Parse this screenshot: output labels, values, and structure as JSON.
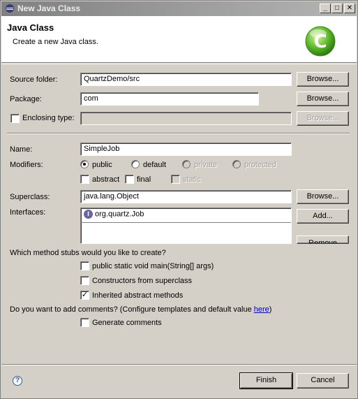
{
  "window": {
    "title": "New Java Class",
    "controls": {
      "minimize": "_",
      "maximize": "□",
      "close": "✕"
    }
  },
  "header": {
    "title": "Java Class",
    "description": "Create a new Java class.",
    "logo_letter": "C"
  },
  "source_folder": {
    "label": "Source folder:",
    "value": "QuartzDemo/src",
    "browse": "Browse..."
  },
  "package": {
    "label": "Package:",
    "value": "com",
    "browse": "Browse..."
  },
  "enclosing": {
    "label": "Enclosing type:",
    "checked": false,
    "value": "",
    "browse": "Browse..."
  },
  "name": {
    "label": "Name:",
    "value": "SimpleJob"
  },
  "modifiers": {
    "label": "Modifiers:",
    "access": [
      {
        "label": "public",
        "selected": true,
        "enabled": true
      },
      {
        "label": "default",
        "selected": false,
        "enabled": true
      },
      {
        "label": "private",
        "selected": false,
        "enabled": false
      },
      {
        "label": "protected",
        "selected": false,
        "enabled": false
      }
    ],
    "flags": [
      {
        "label": "abstract",
        "checked": false,
        "enabled": true
      },
      {
        "label": "final",
        "checked": false,
        "enabled": true
      },
      {
        "label": "static",
        "checked": false,
        "enabled": false
      }
    ]
  },
  "superclass": {
    "label": "Superclass:",
    "value": "java.lang.Object",
    "browse": "Browse..."
  },
  "interfaces": {
    "label": "Interfaces:",
    "items": [
      "org.quartz.Job"
    ],
    "add": "Add...",
    "remove": "Remove"
  },
  "stubs": {
    "question": "Which method stubs would you like to create?",
    "options": [
      {
        "label": "public static void main(String[] args)",
        "checked": false
      },
      {
        "label": "Constructors from superclass",
        "checked": false
      },
      {
        "label": "Inherited abstract methods",
        "checked": true
      }
    ]
  },
  "comments": {
    "question": "Do you want to add comments? (Configure templates and default value ",
    "link": "here",
    "question_end": ")",
    "option": {
      "label": "Generate comments",
      "checked": false
    }
  },
  "footer": {
    "help": "?",
    "finish": "Finish",
    "cancel": "Cancel"
  },
  "glyphs": {
    "check": "✓",
    "interface_icon": "I"
  }
}
